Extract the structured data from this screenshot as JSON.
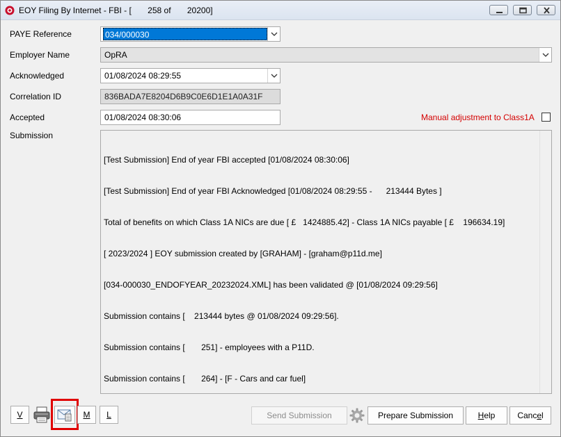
{
  "window": {
    "title": "EOY Filing By Internet - FBI - [       258 of       20200]"
  },
  "form": {
    "paye_label": "PAYE Reference",
    "paye_value": "034/000030",
    "employer_label": "Employer Name",
    "employer_value": "OpRA",
    "acknowledged_label": "Acknowledged",
    "acknowledged_value": "01/08/2024 08:29:55",
    "correlation_label": "Correlation ID",
    "correlation_value": "836BADA7E8204D6B9C0E6D1E1A0A31F",
    "accepted_label": "Accepted",
    "accepted_value": "01/08/2024 08:30:06",
    "manual_adjustment_label": "Manual adjustment to Class1A",
    "submission_label": "Submission"
  },
  "submission_lines": [
    "[Test Submission] End of year FBI accepted [01/08/2024 08:30:06]",
    "[Test Submission] End of year FBI Acknowledged [01/08/2024 08:29:55 -      213444 Bytes ]",
    "Total of benefits on which Class 1A NICs are due [ £   1424885.42] - Class 1A NICs payable [ £    196634.19]",
    "[ 2023/2024 ] EOY submission created by [GRAHAM] - [graham@p11d.me]",
    "[034-000030_ENDOFYEAR_20232024.XML] has been validated @ [01/08/2024 09:29:56]",
    "Submission contains [    213444 bytes @ 01/08/2024 09:29:56].",
    "Submission contains [       251] - employees with a P11D.",
    "Submission contains [       264] - [F - Cars and car fuel]"
  ],
  "buttons": {
    "v": "V",
    "m": "M",
    "l": "L",
    "send": "Send Submission",
    "prepare": "Prepare Submission",
    "help_pre": "",
    "help_u": "H",
    "help_post": "elp",
    "cancel_pre": "Canc",
    "cancel_u": "e",
    "cancel_post": "l"
  },
  "colors": {
    "selection": "#0078d7",
    "manual_label": "#d40000",
    "highlight_box": "#e00000"
  }
}
